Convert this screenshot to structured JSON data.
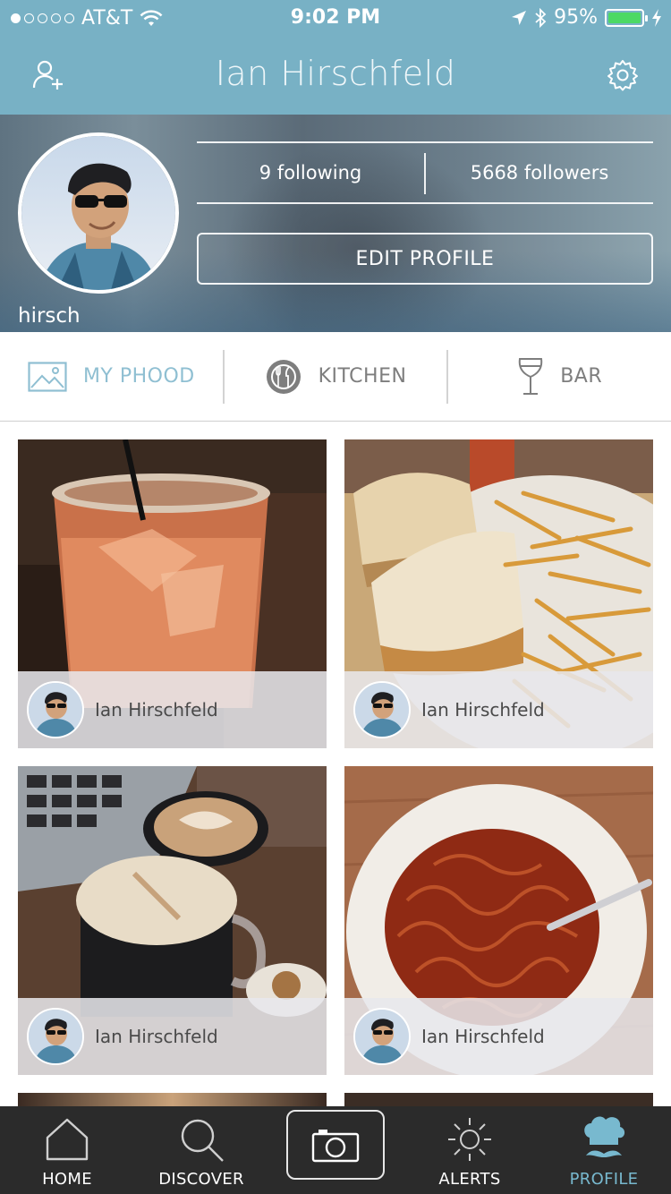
{
  "status_bar": {
    "carrier": "AT&T",
    "time": "9:02 PM",
    "battery": "95%",
    "signal_filled": 1
  },
  "nav": {
    "title": "Ian Hirschfeld"
  },
  "profile": {
    "username": "hirsch",
    "following": "9 following",
    "followers": "5668 followers",
    "edit_label": "EDIT PROFILE"
  },
  "tabs": [
    {
      "label": "MY PHOOD",
      "icon": "image-icon",
      "active": true
    },
    {
      "label": "KITCHEN",
      "icon": "plate-utensils-icon",
      "active": false
    },
    {
      "label": "BAR",
      "icon": "wine-glass-icon",
      "active": false
    }
  ],
  "posts": [
    {
      "author": "Ian Hirschfeld",
      "subject": "cocktail"
    },
    {
      "author": "Ian Hirschfeld",
      "subject": "sandwich-fries"
    },
    {
      "author": "Ian Hirschfeld",
      "subject": "coffee"
    },
    {
      "author": "Ian Hirschfeld",
      "subject": "noodles"
    }
  ],
  "tabbar": {
    "home": "HOME",
    "discover": "DISCOVER",
    "alerts": "ALERTS",
    "profile": "PROFILE"
  },
  "colors": {
    "brand": "#78b1c5",
    "active_tab": "#8fbfd2",
    "tabbar_bg": "#2b2b2b",
    "tabbar_active": "#78b9cf",
    "battery": "#4cd964"
  }
}
